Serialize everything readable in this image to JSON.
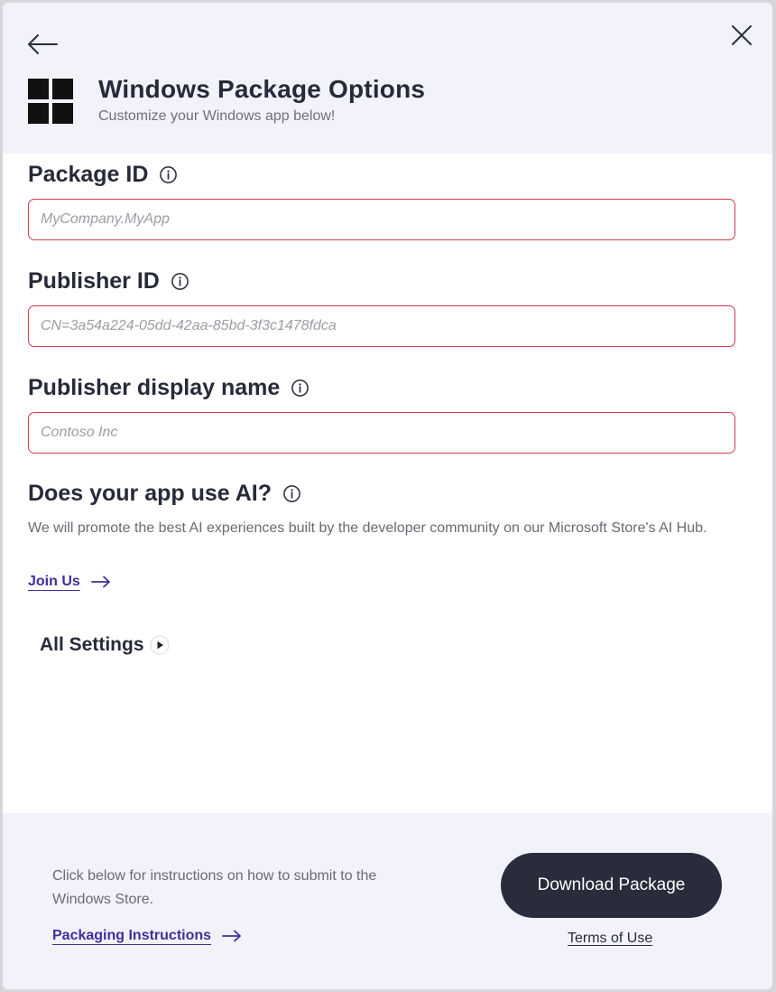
{
  "header": {
    "title": "Windows Package Options",
    "subtitle": "Customize your Windows app below!",
    "back_icon": "arrow-left-icon",
    "close_icon": "close-icon",
    "logo_icon": "windows-logo-icon"
  },
  "fields": [
    {
      "label": "Package ID",
      "placeholder": "MyCompany.MyApp",
      "value": ""
    },
    {
      "label": "Publisher ID",
      "placeholder": "CN=3a54a224-05dd-42aa-85bd-3f3c1478fdca",
      "value": ""
    },
    {
      "label": "Publisher display name",
      "placeholder": "Contoso Inc",
      "value": ""
    }
  ],
  "ai_section": {
    "label": "Does your app use AI?",
    "description": "We will promote the best AI experiences built by the developer community on our Microsoft Store's AI Hub.",
    "join_label": "Join Us"
  },
  "all_settings": {
    "label": "All Settings"
  },
  "footer": {
    "description": "Click below for instructions on how to submit to the Windows Store.",
    "instructions_label": "Packaging Instructions",
    "download_label": "Download Package",
    "terms_label": "Terms of Use"
  },
  "colors": {
    "accent_link": "#3f2f9a",
    "input_border_error": "#d63a4e",
    "primary_button": "#292c3b",
    "panel_background": "#f2f2fb"
  }
}
